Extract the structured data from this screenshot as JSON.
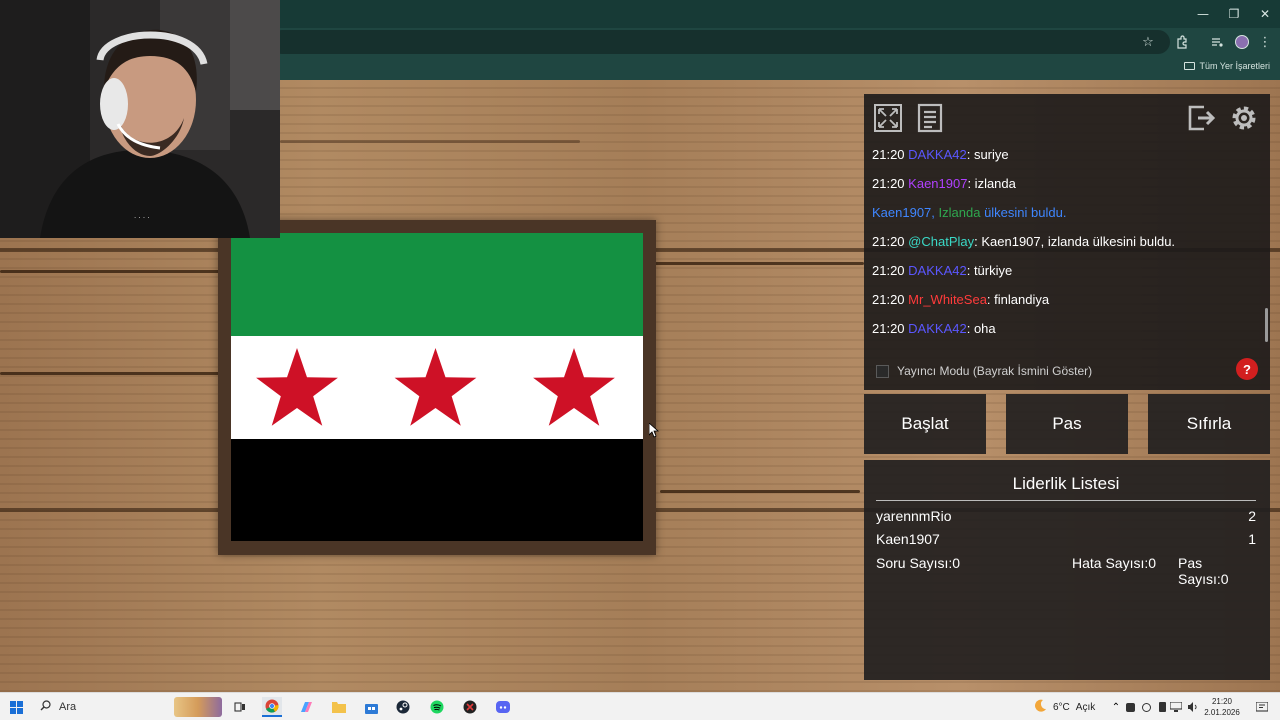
{
  "browser": {
    "bookmarks_all_label": "Tüm Yer İşaretleri",
    "window_controls": {
      "minimize": "—",
      "restore": "❐",
      "close": "✕"
    }
  },
  "game": {
    "flag": {
      "stripes": [
        "#149142",
        "#ffffff",
        "#000000"
      ],
      "star_color": "#ce1126",
      "star_count": 3
    },
    "toolbar_icons": [
      "fullscreen-icon",
      "document-icon",
      "exit-icon",
      "gear-icon"
    ],
    "chat": [
      {
        "time": "21:20",
        "user": "DAKKA42",
        "user_color": "#5b57ff",
        "text": ": suriye"
      },
      {
        "time": "21:20",
        "user": "Kaen1907",
        "user_color": "#b040ff",
        "text": ": izlanda"
      },
      {
        "system": true,
        "parts": [
          "Kaen1907,",
          " Izlanda",
          " ülkesini buldu."
        ],
        "colors": [
          "#3f86ff",
          "#2fa84f",
          "#3f86ff"
        ]
      },
      {
        "time": "21:20",
        "user": "@ChatPlay",
        "user_color": "#3ad8c6",
        "text": ": Kaen1907, izlanda ülkesini buldu."
      },
      {
        "time": "21:20",
        "user": "DAKKA42",
        "user_color": "#5b57ff",
        "text": ": türkiye"
      },
      {
        "time": "21:20",
        "user": "Mr_WhiteSea",
        "user_color": "#ff3b3b",
        "text": ": finlandiya"
      },
      {
        "time": "21:20",
        "user": "DAKKA42",
        "user_color": "#5b57ff",
        "text": ": oha"
      }
    ],
    "streamer_mode_label": "Yayıncı Modu (Bayrak İsmini Göster)",
    "streamer_mode_checked": false,
    "help_label": "?",
    "buttons": {
      "start": "Başlat",
      "pass": "Pas",
      "reset": "Sıfırla"
    },
    "leaderboard": {
      "title": "Liderlik Listesi",
      "rows": [
        {
          "name": "yarennmRio",
          "score": "2"
        },
        {
          "name": "Kaen1907",
          "score": "1"
        }
      ],
      "stats": {
        "questions_label": "Soru Sayısı:",
        "questions": "0",
        "errors_label": "Hata Sayısı:",
        "errors": "0",
        "passes_label": "Pas Sayısı:",
        "passes": "0"
      }
    }
  },
  "taskbar": {
    "search_placeholder": "Ara",
    "weather_temp": "6°C",
    "weather_desc": "Açık",
    "clock_time": "21:20",
    "clock_date": "2.01.2026"
  }
}
